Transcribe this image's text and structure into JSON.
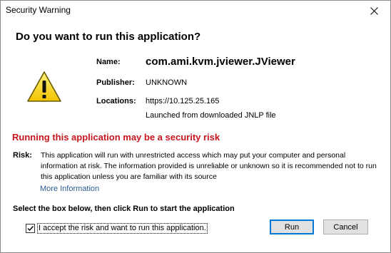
{
  "window": {
    "title": "Security Warning",
    "close_icon": "close-icon"
  },
  "dialog": {
    "headline": "Do you want to run this application?",
    "warning_icon": "warning-triangle-icon",
    "fields": {
      "name_label": "Name:",
      "name_value": "com.ami.kvm.jviewer.JViewer",
      "publisher_label": "Publisher:",
      "publisher_value": "UNKNOWN",
      "locations_label": "Locations:",
      "location_url": "https://10.125.25.165",
      "location_note": "Launched from downloaded JNLP file"
    },
    "risk_headline": "Running this application may be a security risk",
    "risk_label": "Risk:",
    "risk_text": "This application will run with unrestricted access which may put your computer and personal information at risk. The information provided is unreliable or unknown so it is recommended not to run this application unless you are familiar with its source",
    "more_info_link": "More Information",
    "instruction": "Select the box below, then click Run to start the application",
    "accept_label": "I accept the risk and want to run this application.",
    "accept_checked": true,
    "buttons": {
      "run": "Run",
      "cancel": "Cancel"
    },
    "colors": {
      "risk_red": "#c8141e",
      "link_blue": "#2a5b92",
      "focus_blue": "#0078d7",
      "warning_yellow": "#f7d51d"
    }
  }
}
